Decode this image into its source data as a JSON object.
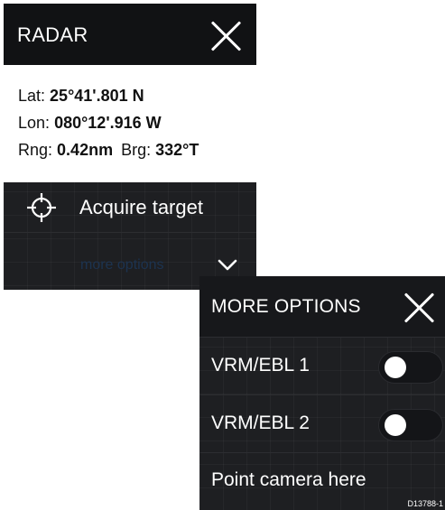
{
  "radar_menu": {
    "title": "RADAR",
    "close_icon": "close-icon",
    "position": {
      "lat_label": "Lat:",
      "lat_value": "25°41'.801 N",
      "lon_label": "Lon:",
      "lon_value": "080°12'.916 W",
      "rng_label": "Rng:",
      "rng_value": "0.42nm",
      "brg_label": "Brg:",
      "brg_value": "332°T"
    },
    "acquire": {
      "icon": "target-crosshair-icon",
      "label": "Acquire target"
    },
    "more": {
      "label": "more options",
      "icon": "chevron-down-icon"
    }
  },
  "options_menu": {
    "title": "MORE OPTIONS",
    "close_icon": "close-icon",
    "items": [
      {
        "label": "VRM/EBL 1",
        "toggle_on": false
      },
      {
        "label": "VRM/EBL 2",
        "toggle_on": false
      },
      {
        "label": "Point camera here"
      }
    ]
  },
  "reference_code": "D13788-1",
  "colors": {
    "panel_background": "#1c1d20",
    "header_background": "#111214",
    "text": "#ffffff",
    "more_options_text": "#1c3350"
  }
}
